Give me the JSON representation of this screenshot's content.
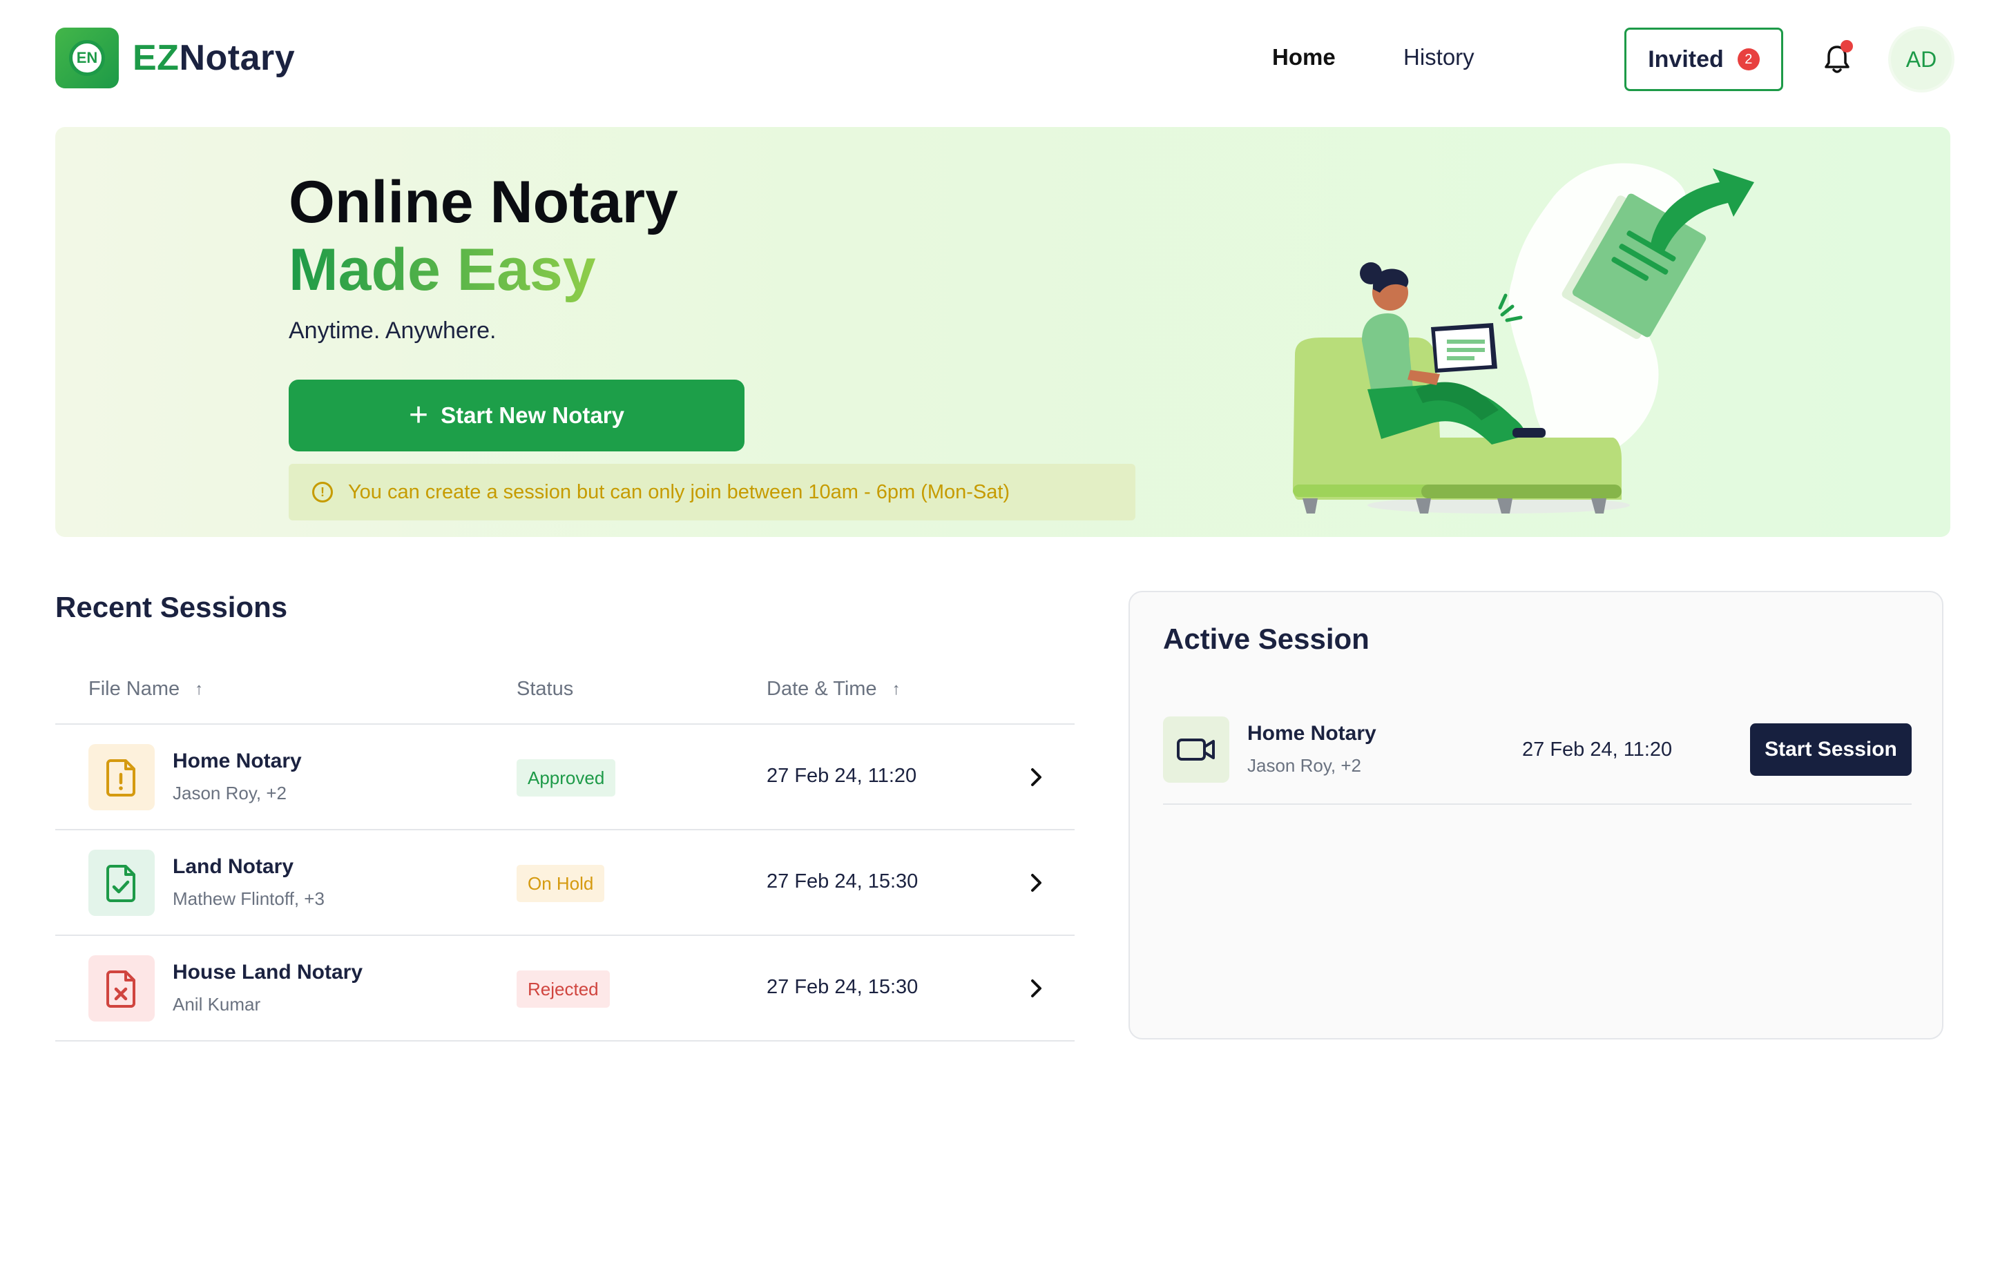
{
  "header": {
    "logo_badge": "EN",
    "logo_ez": "EZ",
    "logo_rest": "Notary",
    "nav": {
      "home": "Home",
      "history": "History"
    },
    "invited_label": "Invited",
    "invited_count": "2",
    "avatar_initials": "AD"
  },
  "hero": {
    "title_line1": "Online Notary",
    "title_line2": "Made Easy",
    "subtitle": "Anytime. Anywhere.",
    "cta_label": "Start New Notary",
    "notice": "You can create a session but can only join between 10am - 6pm (Mon-Sat)"
  },
  "recent": {
    "title": "Recent Sessions",
    "columns": {
      "file_name": "File Name",
      "status": "Status",
      "date_time": "Date & Time"
    },
    "rows": [
      {
        "name": "Home Notary",
        "people": "Jason Roy, +2",
        "status": "Approved",
        "date": "27 Feb 24, 11:20",
        "icon": "document-alert-icon"
      },
      {
        "name": "Land Notary",
        "people": "Mathew Flintoff, +3",
        "status": "On Hold",
        "date": "27 Feb 24, 15:30",
        "icon": "document-check-icon"
      },
      {
        "name": "House Land Notary",
        "people": "Anil Kumar",
        "status": "Rejected",
        "date": "27 Feb 24, 15:30",
        "icon": "document-x-icon"
      }
    ]
  },
  "active": {
    "title": "Active Session",
    "name": "Home Notary",
    "people": "Jason Roy, +2",
    "date": "27 Feb 24, 11:20",
    "button": "Start Session",
    "icon": "video-camera-icon"
  },
  "colors": {
    "brand_green": "#1d9f49",
    "dark_navy": "#17203f",
    "approved": "#1d9a48",
    "on_hold": "#d59a10",
    "rejected": "#d0453f",
    "notice_text": "#c69b00"
  }
}
